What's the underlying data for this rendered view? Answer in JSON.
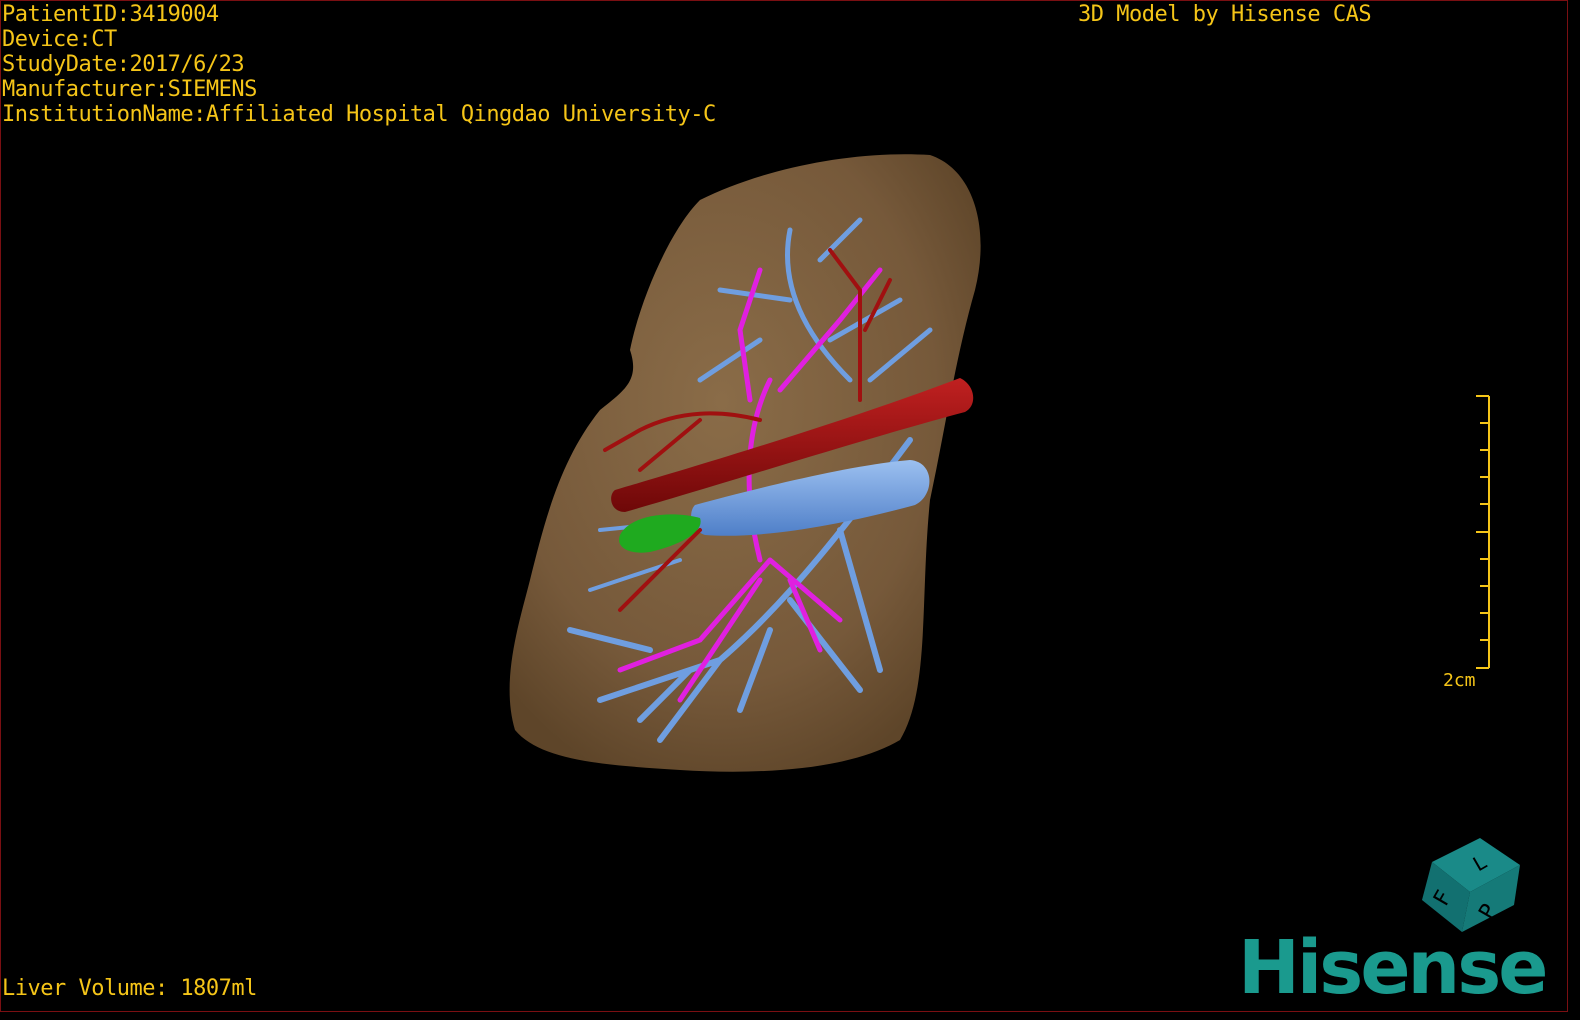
{
  "overlay": {
    "patient_id": "PatientID:3419004",
    "device": "Device:CT",
    "study_date": "StudyDate:2017/6/23",
    "manufacturer": "Manufacturer:SIEMENS",
    "institution": "InstitutionName:Affiliated Hospital Qingdao University-C",
    "model_credit": "3D Model by Hisense CAS",
    "liver_volume": "Liver Volume: 1807ml"
  },
  "scale_bar": {
    "label": "2cm"
  },
  "orientation_cube": {
    "letters": [
      "F",
      "L",
      "P"
    ],
    "color": "#127a78"
  },
  "logo": {
    "text": "Hisense",
    "color": "#1a9a8e"
  },
  "colors": {
    "text": "#f5c518",
    "liver": "#7a5c3a",
    "hepatic_vein": "#6f9ee0",
    "portal_vein": "#e020e0",
    "artery": "#a01010",
    "gallbladder": "#1faa1f"
  }
}
